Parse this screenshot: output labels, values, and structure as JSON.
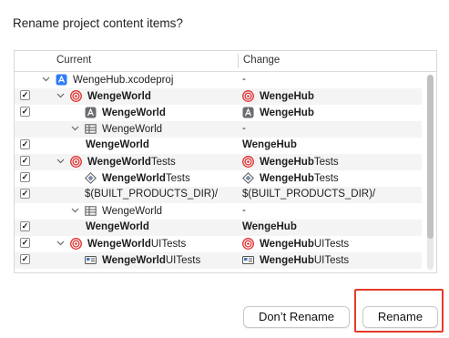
{
  "dialog": {
    "title": "Rename project content items?"
  },
  "table": {
    "col_current": "Current",
    "col_change": "Change",
    "rows": [
      {
        "check": false,
        "indent": 0,
        "chev": "v",
        "icon": "xcodeproj-icon",
        "cur_a": "WengeHub.xcodeproj",
        "cur_b": "",
        "chg_a": "-",
        "chg_b": "",
        "chg_icon": "",
        "bold": false
      },
      {
        "check": true,
        "indent": 1,
        "chev": "v",
        "icon": "target-icon",
        "cur_a": "WengeWorld",
        "cur_b": "",
        "chg_a": "WengeHub",
        "chg_b": "",
        "chg_icon": "target-icon",
        "bold": true
      },
      {
        "check": true,
        "indent": 2,
        "chev": "",
        "icon": "app-icon",
        "cur_a": "WengeWorld",
        "cur_b": "",
        "chg_a": "WengeHub",
        "chg_b": "",
        "chg_icon": "app-icon",
        "bold": true
      },
      {
        "check": false,
        "indent": 2,
        "chev": "v",
        "icon": "table-icon",
        "cur_a": "WengeWorld",
        "cur_b": "",
        "chg_a": "-",
        "chg_b": "",
        "chg_icon": "",
        "bold": false
      },
      {
        "check": true,
        "indent": 3,
        "chev": "",
        "icon": "",
        "cur_a": "WengeWorld",
        "cur_b": "",
        "chg_a": "WengeHub",
        "chg_b": "",
        "chg_icon": "",
        "bold": true
      },
      {
        "check": true,
        "indent": 1,
        "chev": "v",
        "icon": "target-icon",
        "cur_a": "WengeWorld",
        "cur_b": "Tests",
        "chg_a": "WengeHub",
        "chg_b": "Tests",
        "chg_icon": "target-icon",
        "bold": true
      },
      {
        "check": true,
        "indent": 2,
        "chev": "",
        "icon": "test-bundle-icon",
        "cur_a": "WengeWorld",
        "cur_b": "Tests",
        "chg_a": "WengeHub",
        "chg_b": "Tests",
        "chg_icon": "test-bundle-icon",
        "bold": true
      },
      {
        "check": true,
        "indent": 2,
        "chev": "",
        "icon": "",
        "cur_a": "$(BUILT_PRODUCTS_DIR)/",
        "cur_b": "",
        "chg_a": "$(BUILT_PRODUCTS_DIR)/",
        "chg_b": "",
        "chg_icon": "",
        "bold": false
      },
      {
        "check": false,
        "indent": 2,
        "chev": "v",
        "icon": "table-icon",
        "cur_a": "WengeWorld",
        "cur_b": "",
        "chg_a": "-",
        "chg_b": "",
        "chg_icon": "",
        "bold": false
      },
      {
        "check": true,
        "indent": 3,
        "chev": "",
        "icon": "",
        "cur_a": "WengeWorld",
        "cur_b": "",
        "chg_a": "WengeHub",
        "chg_b": "",
        "chg_icon": "",
        "bold": true
      },
      {
        "check": true,
        "indent": 1,
        "chev": "v",
        "icon": "target-icon",
        "cur_a": "WengeWorld",
        "cur_b": "UITests",
        "chg_a": "WengeHub",
        "chg_b": "UITests",
        "chg_icon": "target-icon",
        "bold": true
      },
      {
        "check": true,
        "indent": 2,
        "chev": "",
        "icon": "ui-test-bundle-icon",
        "cur_a": "WengeWorld",
        "cur_b": "UITests",
        "chg_a": "WengeHub",
        "chg_b": "UITests",
        "chg_icon": "ui-test-bundle-icon",
        "bold": true
      }
    ]
  },
  "buttons": {
    "dont_rename": "Don’t Rename",
    "rename": "Rename"
  },
  "colors": {
    "highlight": "#e53a2a",
    "target": "#e0312f",
    "xcode": "#2f7cf6"
  }
}
